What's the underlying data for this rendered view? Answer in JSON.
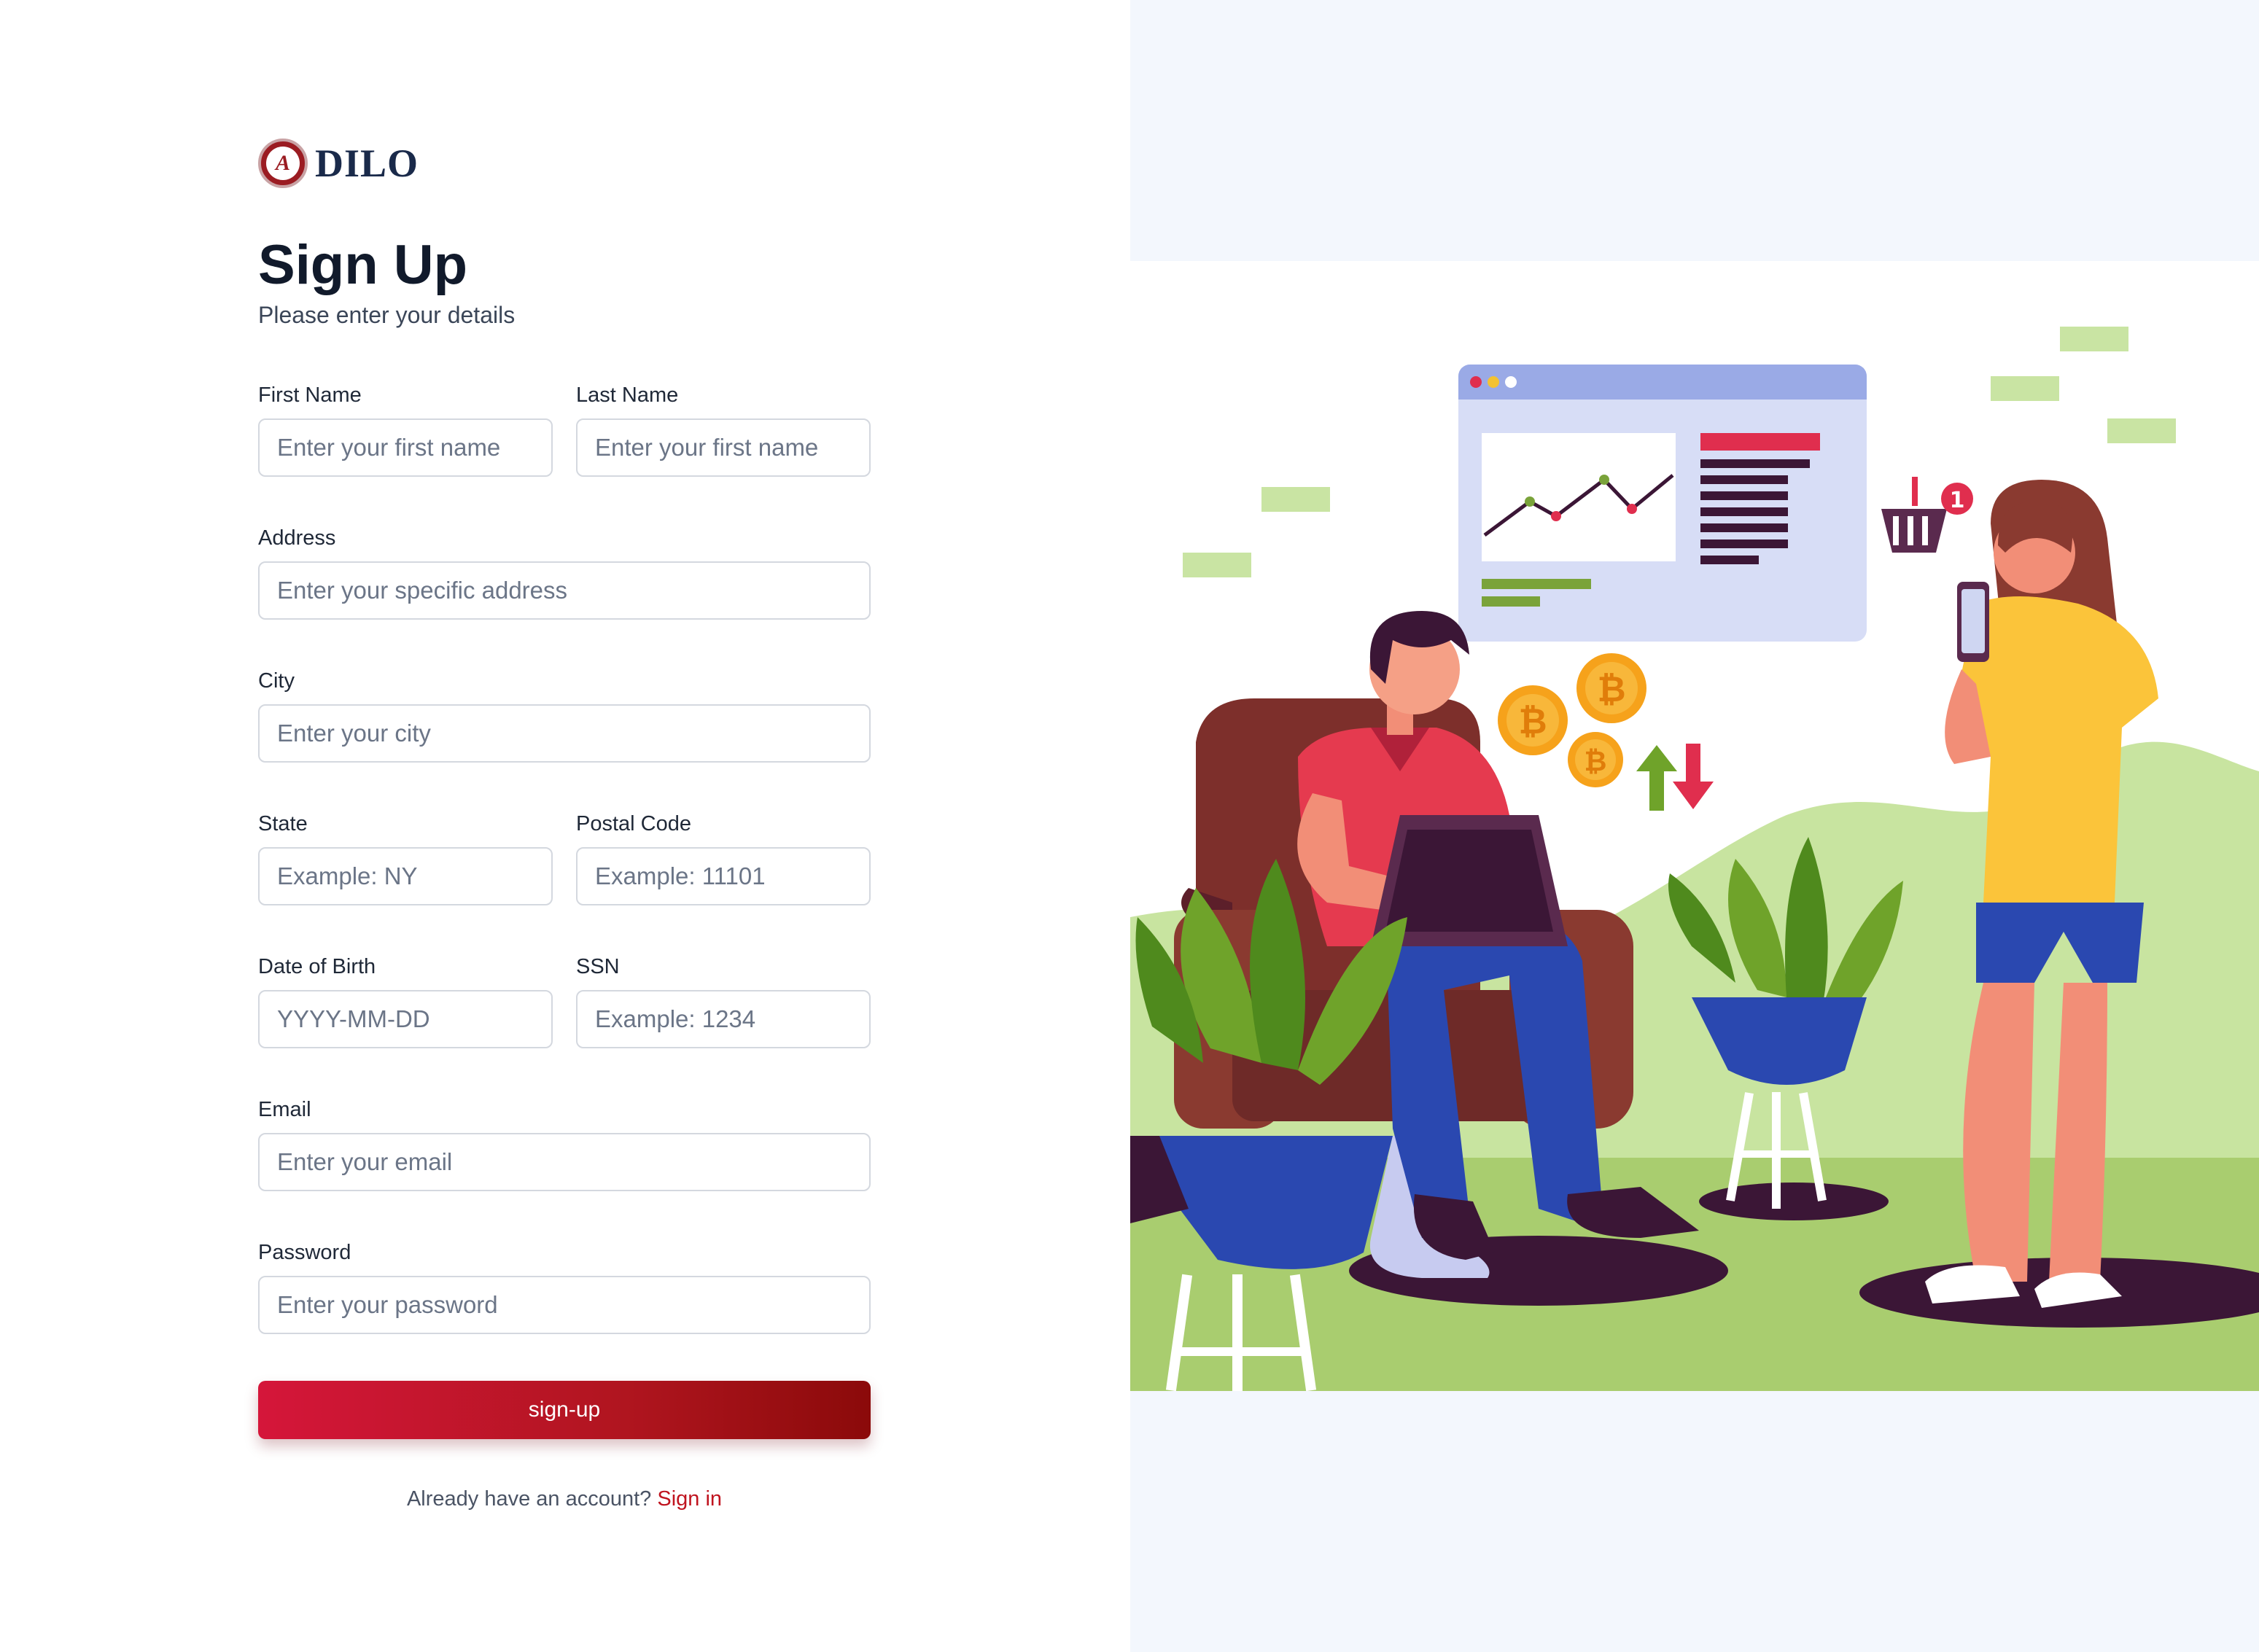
{
  "brand": {
    "name": "DILO",
    "seal_letter": "A"
  },
  "heading": {
    "title": "Sign Up",
    "subtitle": "Please enter your details"
  },
  "form": {
    "first_name": {
      "label": "First Name",
      "placeholder": "Enter your first name"
    },
    "last_name": {
      "label": "Last Name",
      "placeholder": "Enter your first name"
    },
    "address": {
      "label": "Address",
      "placeholder": "Enter your specific address"
    },
    "city": {
      "label": "City",
      "placeholder": "Enter your city"
    },
    "state": {
      "label": "State",
      "placeholder": "Example: NY"
    },
    "postal_code": {
      "label": "Postal Code",
      "placeholder": "Example: 11101"
    },
    "dob": {
      "label": "Date of Birth",
      "placeholder": "YYYY-MM-DD"
    },
    "ssn": {
      "label": "SSN",
      "placeholder": "Example: 1234"
    },
    "email": {
      "label": "Email",
      "placeholder": "Enter your email"
    },
    "password": {
      "label": "Password",
      "placeholder": "Enter your password"
    },
    "submit_label": "sign-up"
  },
  "footer": {
    "prompt": "Already have an account?",
    "link": "Sign in"
  },
  "illustration": {
    "cart_badge": "1",
    "coin_symbol": "₿"
  },
  "colors": {
    "accent": "#c0141f",
    "button_start": "#d5163a",
    "button_end": "#8b0a0a",
    "panel_bg": "#f3f7fd"
  }
}
